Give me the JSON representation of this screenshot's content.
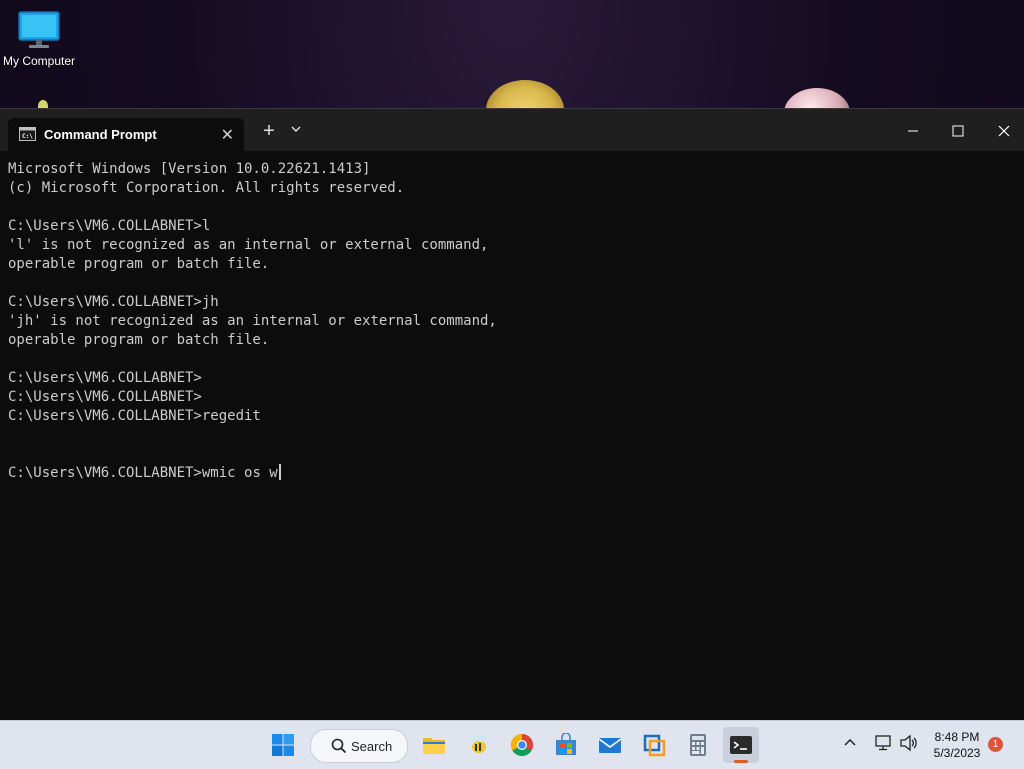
{
  "desktop": {
    "icons": [
      {
        "label": "My Computer",
        "icon": "monitor-icon"
      }
    ]
  },
  "window": {
    "tab_title": "Command Prompt",
    "tab_icon": "cmd-icon",
    "console_lines": [
      "Microsoft Windows [Version 10.0.22621.1413]",
      "(c) Microsoft Corporation. All rights reserved.",
      "",
      "C:\\Users\\VM6.COLLABNET>l",
      "'l' is not recognized as an internal or external command,",
      "operable program or batch file.",
      "",
      "C:\\Users\\VM6.COLLABNET>jh",
      "'jh' is not recognized as an internal or external command,",
      "operable program or batch file.",
      "",
      "C:\\Users\\VM6.COLLABNET>",
      "C:\\Users\\VM6.COLLABNET>",
      "C:\\Users\\VM6.COLLABNET>regedit",
      "",
      ""
    ],
    "prompt": "C:\\Users\\VM6.COLLABNET>",
    "current_input": "wmic os w",
    "colors": {
      "background": "#0c0c0c",
      "text": "#cccccc",
      "titlebar": "#1f1f1f"
    }
  },
  "taskbar": {
    "search_label": "Search",
    "apps": [
      "start-icon",
      "search-icon",
      "file-explorer-icon",
      "bee-app-icon",
      "chrome-icon",
      "microsoft-store-icon",
      "mail-icon",
      "virtualbox-icon",
      "calculator-icon",
      "terminal-icon"
    ],
    "clock_time": "8:48 PM",
    "clock_date": "5/3/2023",
    "notification_count": "1",
    "accent": "#e05a2a"
  }
}
